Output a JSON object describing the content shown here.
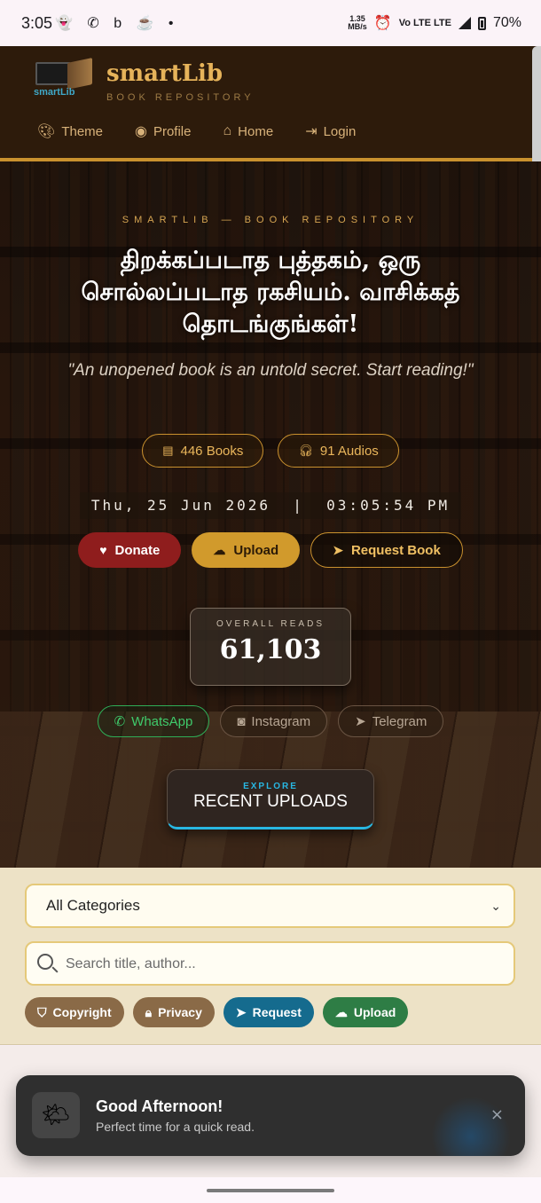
{
  "status_bar": {
    "time": "3:05",
    "left_icons": "👻 ✆ b ☕ •",
    "speed": "1.35\nMB/s",
    "network": "Vo LTE LTE",
    "battery": "70%"
  },
  "header": {
    "brand": "smartLib",
    "tagline": "BOOK REPOSITORY",
    "logo_text": "smartLib",
    "nav": [
      {
        "label": "Theme",
        "icon": "palette-icon"
      },
      {
        "label": "Profile",
        "icon": "user-icon"
      },
      {
        "label": "Home",
        "icon": "home-icon"
      },
      {
        "label": "Login",
        "icon": "login-icon"
      }
    ]
  },
  "hero": {
    "eyebrow": "SMARTLIB — BOOK REPOSITORY",
    "headline": "திறக்கப்படாத புத்தகம், ஒரு சொல்லப்படாத ரகசியம். வாசிக்கத் தொடங்குங்கள்!",
    "quote": "\"An unopened book is an untold secret. Start reading!\"",
    "stats": {
      "books": "446 Books",
      "audios": "91 Audios"
    },
    "clock": "Thu, 25 Jun 2026  |  03:05:54 PM",
    "actions": {
      "donate": "Donate",
      "upload": "Upload",
      "request": "Request Book"
    },
    "reads": {
      "label": "OVERALL READS",
      "value": "61,103"
    },
    "socials": {
      "whatsapp": "WhatsApp",
      "instagram": "Instagram",
      "telegram": "Telegram"
    },
    "explore": {
      "small": "EXPLORE",
      "big": "RECENT UPLOADS"
    }
  },
  "filters": {
    "category_selected": "All Categories",
    "search_placeholder": "Search title, author...",
    "chips": {
      "copyright": "Copyright",
      "privacy": "Privacy",
      "request": "Request",
      "upload": "Upload"
    }
  },
  "toast": {
    "title": "Good Afternoon!",
    "subtitle": "Perfect time for a quick read.",
    "close": "×"
  },
  "colors": {
    "accent_gold": "#c9912e",
    "header_bg": "#2d1b0b",
    "donate": "#8f1d1d",
    "request_chip": "#156b8e",
    "upload_chip": "#2e7d45",
    "explore_accent": "#28b7e2"
  }
}
